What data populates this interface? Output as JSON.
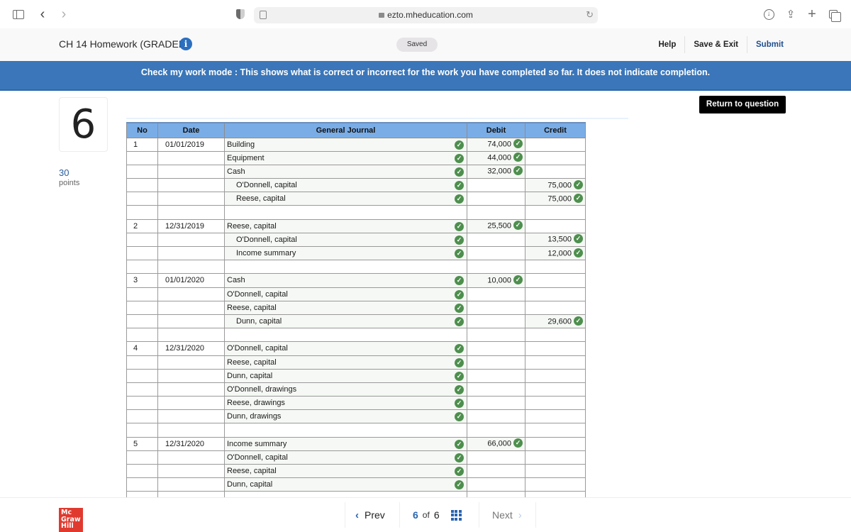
{
  "browser": {
    "url": "ezto.mheducation.com",
    "back_glyph": "‹",
    "forward_glyph": "›",
    "newtab_glyph": "+",
    "share_glyph": "⇪",
    "reload_glyph": "↻",
    "download_glyph": "↓"
  },
  "header": {
    "title": "CH 14 Homework (GRADED)",
    "info_glyph": "i",
    "saved": "Saved",
    "links": {
      "help": "Help",
      "save_exit": "Save & Exit",
      "submit": "Submit"
    }
  },
  "banner": {
    "text": "Check my work mode : This shows what is correct or incorrect for the work you have completed so far. It does not indicate completion."
  },
  "question": {
    "number": "6",
    "points": "30",
    "points_label": "points",
    "return_button": "Return to question"
  },
  "journal": {
    "columns": [
      "No",
      "Date",
      "General Journal",
      "Debit",
      "Credit"
    ],
    "check_glyph": "✓",
    "status_color": "#4e8f4e",
    "rows": [
      {
        "no": "1",
        "date": "01/01/2019",
        "account": "Building",
        "indent": false,
        "debit": "74,000",
        "credit": "",
        "checked": true
      },
      {
        "no": "",
        "date": "",
        "account": "Equipment",
        "indent": false,
        "debit": "44,000",
        "credit": "",
        "checked": true
      },
      {
        "no": "",
        "date": "",
        "account": "Cash",
        "indent": false,
        "debit": "32,000",
        "credit": "",
        "checked": true
      },
      {
        "no": "",
        "date": "",
        "account": "O'Donnell, capital",
        "indent": true,
        "debit": "",
        "credit": "75,000",
        "checked": true
      },
      {
        "no": "",
        "date": "",
        "account": "Reese, capital",
        "indent": true,
        "debit": "",
        "credit": "75,000",
        "checked": true
      },
      {
        "no": "",
        "date": "",
        "account": "",
        "indent": false,
        "debit": "",
        "credit": "",
        "checked": false
      },
      {
        "no": "2",
        "date": "12/31/2019",
        "account": "Reese, capital",
        "indent": false,
        "debit": "25,500",
        "credit": "",
        "checked": true
      },
      {
        "no": "",
        "date": "",
        "account": "O'Donnell, capital",
        "indent": true,
        "debit": "",
        "credit": "13,500",
        "checked": true
      },
      {
        "no": "",
        "date": "",
        "account": "Income summary",
        "indent": true,
        "debit": "",
        "credit": "12,000",
        "checked": true
      },
      {
        "no": "",
        "date": "",
        "account": "",
        "indent": false,
        "debit": "",
        "credit": "",
        "checked": false
      },
      {
        "no": "3",
        "date": "01/01/2020",
        "account": "Cash",
        "indent": false,
        "debit": "10,000",
        "credit": "",
        "checked": true
      },
      {
        "no": "",
        "date": "",
        "account": "O'Donnell, capital",
        "indent": false,
        "debit": "",
        "credit": "",
        "checked": true
      },
      {
        "no": "",
        "date": "",
        "account": "Reese, capital",
        "indent": false,
        "debit": "",
        "credit": "",
        "checked": true
      },
      {
        "no": "",
        "date": "",
        "account": "Dunn, capital",
        "indent": true,
        "debit": "",
        "credit": "29,600",
        "checked": true
      },
      {
        "no": "",
        "date": "",
        "account": "",
        "indent": false,
        "debit": "",
        "credit": "",
        "checked": false
      },
      {
        "no": "4",
        "date": "12/31/2020",
        "account": "O'Donnell, capital",
        "indent": false,
        "debit": "",
        "credit": "",
        "checked": true
      },
      {
        "no": "",
        "date": "",
        "account": "Reese, capital",
        "indent": false,
        "debit": "",
        "credit": "",
        "checked": true
      },
      {
        "no": "",
        "date": "",
        "account": "Dunn, capital",
        "indent": false,
        "debit": "",
        "credit": "",
        "checked": true
      },
      {
        "no": "",
        "date": "",
        "account": "O'Donnell, drawings",
        "indent": false,
        "debit": "",
        "credit": "",
        "checked": true
      },
      {
        "no": "",
        "date": "",
        "account": "Reese, drawings",
        "indent": false,
        "debit": "",
        "credit": "",
        "checked": true
      },
      {
        "no": "",
        "date": "",
        "account": "Dunn, drawings",
        "indent": false,
        "debit": "",
        "credit": "",
        "checked": true
      },
      {
        "no": "",
        "date": "",
        "account": "",
        "indent": false,
        "debit": "",
        "credit": "",
        "checked": false
      },
      {
        "no": "5",
        "date": "12/31/2020",
        "account": "Income summary",
        "indent": false,
        "debit": "66,000",
        "credit": "",
        "checked": true
      },
      {
        "no": "",
        "date": "",
        "account": "O'Donnell, capital",
        "indent": false,
        "debit": "",
        "credit": "",
        "checked": true
      },
      {
        "no": "",
        "date": "",
        "account": "Reese, capital",
        "indent": false,
        "debit": "",
        "credit": "",
        "checked": true
      },
      {
        "no": "",
        "date": "",
        "account": "Dunn, capital",
        "indent": false,
        "debit": "",
        "credit": "",
        "checked": true
      },
      {
        "no": "",
        "date": "",
        "account": "",
        "indent": false,
        "debit": "",
        "credit": "",
        "checked": false
      }
    ]
  },
  "footer": {
    "logo_lines": [
      "Mc",
      "Graw",
      "Hill"
    ],
    "prev": "Prev",
    "prev_glyph": "‹",
    "current_page": "6",
    "of": "of",
    "total_pages": "6",
    "next": "Next",
    "next_glyph": "›"
  }
}
